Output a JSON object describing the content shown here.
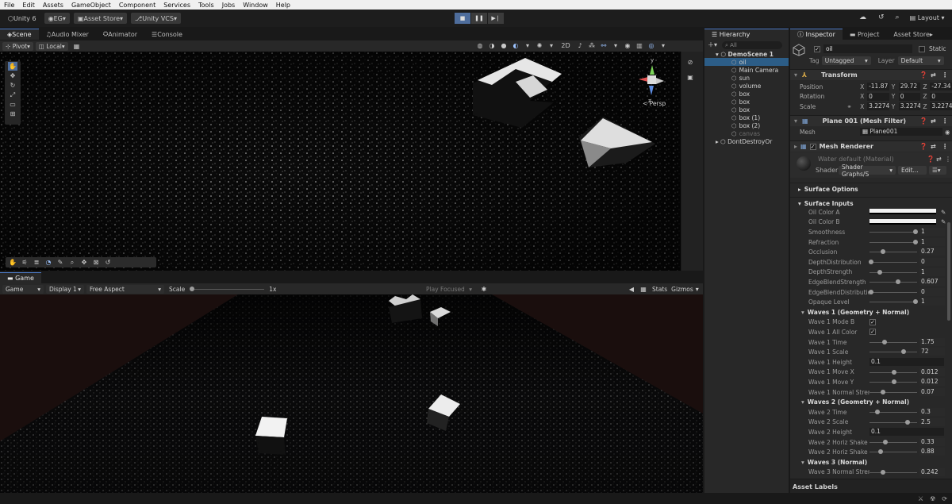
{
  "menubar": {
    "items": [
      "File",
      "Edit",
      "Assets",
      "GameObject",
      "Component",
      "Services",
      "Tools",
      "Jobs",
      "Window",
      "Help"
    ]
  },
  "toolbar": {
    "unity": "Unity 6",
    "account": "EG",
    "asset_store": "Asset Store",
    "vcs": "Unity VCS",
    "layout": "Layout"
  },
  "scene_tabs": [
    "Scene",
    "Audio Mixer",
    "Animator",
    "Console"
  ],
  "scene_toolbar": {
    "pivot": "Pivot",
    "local": "Local",
    "toggle_2d": "2D",
    "persp": "< Persp"
  },
  "game": {
    "tab": "Game",
    "mode": "Game",
    "display": "Display 1",
    "aspect": "Free Aspect",
    "scale_label": "Scale",
    "scale_value": "1x",
    "play_focused": "Play Focused",
    "stats": "Stats",
    "gizmos": "Gizmos"
  },
  "hierarchy": {
    "tab": "Hierarchy",
    "search": "All",
    "scene": "DemoScene 1",
    "items": [
      "oil",
      "Main Camera",
      "sun",
      "volume",
      "box",
      "box",
      "box",
      "box (1)",
      "box (2)",
      "canvas"
    ],
    "dont_destroy": "DontDestroyOr"
  },
  "inspector": {
    "tabs": [
      "Inspector",
      "Project",
      "Asset Store"
    ],
    "object_name": "oil",
    "static": "Static",
    "tag_label": "Tag",
    "tag": "Untagged",
    "layer_label": "Layer",
    "layer": "Default",
    "transform": {
      "title": "Transform",
      "position": {
        "label": "Position",
        "x": "-11.87",
        "y": "29.72",
        "z": "-27.34"
      },
      "rotation": {
        "label": "Rotation",
        "x": "0",
        "y": "0",
        "z": "0"
      },
      "scale": {
        "label": "Scale",
        "x": "3.2274",
        "y": "3.2274",
        "z": "3.2274"
      }
    },
    "mesh_filter": {
      "title": "Plane 001 (Mesh Filter)",
      "label": "Mesh",
      "value": "Plane001"
    },
    "mesh_renderer": {
      "title": "Mesh Renderer"
    },
    "material": {
      "name": "Water default (Material)",
      "shader_label": "Shader",
      "shader": "Shader Graphs/S",
      "edit": "Edit..."
    },
    "surface_options": "Surface Options",
    "surface_inputs": "Surface Inputs",
    "properties": [
      {
        "label": "Oil Color A",
        "type": "color"
      },
      {
        "label": "Oil Color B",
        "type": "color"
      },
      {
        "label": "Smoothness",
        "value": "1",
        "slider": 1.0
      },
      {
        "label": "Refraction",
        "value": "1",
        "slider": 1.0
      },
      {
        "label": "Occlusion",
        "value": "0.27",
        "slider": 0.27
      },
      {
        "label": "DepthDistribution",
        "value": "0",
        "slider": 0.0
      },
      {
        "label": "DepthStrength",
        "value": "1",
        "slider": 0.2
      },
      {
        "label": "EdgeBlendStrength",
        "value": "0.607",
        "slider": 0.61
      },
      {
        "label": "EdgeBlendDistributio",
        "value": "0",
        "slider": 0.0
      },
      {
        "label": "Opaque Level",
        "value": "1",
        "slider": 1.0
      },
      {
        "label": "Waves 1 (Geometry + Normal)",
        "type": "header"
      },
      {
        "label": "Wave 1 Mode B",
        "type": "check"
      },
      {
        "label": "Wave 1 All Color",
        "type": "check"
      },
      {
        "label": "Wave 1 Time",
        "value": "1.75",
        "slider": 0.3
      },
      {
        "label": "Wave 1 Scale",
        "value": "72",
        "slider": 0.73
      },
      {
        "label": "Wave 1 Height",
        "value": "0.1",
        "type": "field"
      },
      {
        "label": "Wave 1 Move X",
        "value": "0.012",
        "slider": 0.52
      },
      {
        "label": "Wave 1 Move Y",
        "value": "0.012",
        "slider": 0.52
      },
      {
        "label": "Wave 1 Normal Streng",
        "value": "0.07",
        "slider": 0.26
      },
      {
        "label": "Waves 2 (Geometry + Normal)",
        "type": "header"
      },
      {
        "label": "Wave 2 Time",
        "value": "0.3",
        "slider": 0.14
      },
      {
        "label": "Wave 2 Scale",
        "value": "2.5",
        "slider": 0.82
      },
      {
        "label": "Wave 2 Height",
        "value": "0.1",
        "type": "field"
      },
      {
        "label": "Wave 2 Horiz Shake",
        "value": "0.33",
        "slider": 0.33
      },
      {
        "label": "Wave 2 Horiz Shake",
        "value": "0.88",
        "slider": 0.22
      },
      {
        "label": "Waves 3 (Normal)",
        "type": "header"
      },
      {
        "label": "Wave 3 Normal Streng",
        "value": "0.242",
        "slider": 0.26
      }
    ],
    "asset_labels": "Asset Labels"
  }
}
